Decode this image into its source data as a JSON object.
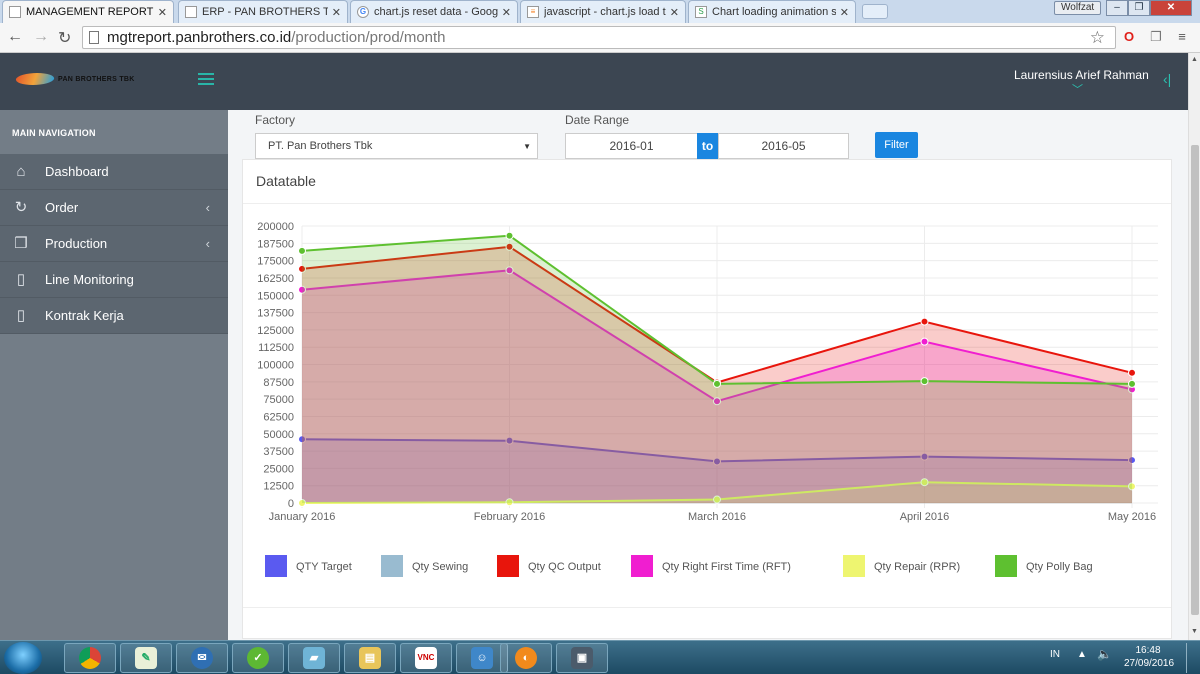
{
  "browser": {
    "tabs": [
      {
        "label": "MANAGEMENT REPORT -",
        "active": true
      },
      {
        "label": "ERP - PAN BROTHERS TBK",
        "active": false
      },
      {
        "label": "chart.js reset data - Googl",
        "active": false
      },
      {
        "label": "javascript - chart.js load to",
        "active": false
      },
      {
        "label": "Chart loading animation st",
        "active": false
      }
    ],
    "profile": "Wolfzat",
    "url_host": "mgtreport.panbrothers.co.id",
    "url_path": "/production/prod/month"
  },
  "header": {
    "logo_text": "PAN BROTHERS TBK",
    "user_name": "Laurensius Arief Rahman"
  },
  "sidebar": {
    "heading": "MAIN NAVIGATION",
    "items": [
      {
        "label": "Dashboard",
        "icon": "home-icon",
        "glyph": "⌂",
        "expandable": false
      },
      {
        "label": "Order",
        "icon": "refresh-icon",
        "glyph": "↻",
        "expandable": true
      },
      {
        "label": "Production",
        "icon": "cube-icon",
        "glyph": "❒",
        "expandable": true
      },
      {
        "label": "Line Monitoring",
        "icon": "clipboard-icon",
        "glyph": "▯",
        "expandable": false
      },
      {
        "label": "Kontrak Kerja",
        "icon": "clipboard-icon",
        "glyph": "▯",
        "expandable": false
      }
    ]
  },
  "filters": {
    "factory_label": "Factory",
    "factory_value": "PT. Pan Brothers Tbk",
    "date_range_label": "Date Range",
    "date_from": "2016-01",
    "date_to_label": "to",
    "date_to": "2016-05",
    "filter_button": "Filter"
  },
  "panel": {
    "title": "Datatable"
  },
  "chart_data": {
    "type": "area",
    "categories": [
      "January 2016",
      "February 2016",
      "March 2016",
      "April 2016",
      "May 2016"
    ],
    "ylim": [
      0,
      200000
    ],
    "yticks": [
      0,
      12500,
      25000,
      37500,
      50000,
      62500,
      75000,
      87500,
      100000,
      112500,
      125000,
      137500,
      150000,
      162500,
      175000,
      187500,
      200000
    ],
    "grid": true,
    "legend_position": "bottom",
    "series": [
      {
        "name": "QTY Target",
        "color": "#5a5af0",
        "values": [
          46000,
          45000,
          30000,
          33500,
          31000
        ]
      },
      {
        "name": "Qty Sewing",
        "color": "#99bbd0",
        "values": [
          null,
          null,
          null,
          null,
          null
        ]
      },
      {
        "name": "Qty QC Output",
        "color": "#e8150c",
        "values": [
          169000,
          185000,
          87000,
          131000,
          94000
        ]
      },
      {
        "name": "Qty Right First Time (RFT)",
        "color": "#f01ed0",
        "values": [
          154000,
          168000,
          73500,
          116500,
          82000
        ]
      },
      {
        "name": "Qty Repair (RPR)",
        "color": "#eef570",
        "values": [
          0,
          500,
          2500,
          15000,
          12000
        ]
      },
      {
        "name": "Qty Polly Bag",
        "color": "#5ec030",
        "values": [
          182000,
          193000,
          86000,
          88000,
          86000
        ]
      }
    ]
  },
  "taskbar": {
    "language": "IN",
    "time": "16:48",
    "date": "27/09/2016"
  }
}
